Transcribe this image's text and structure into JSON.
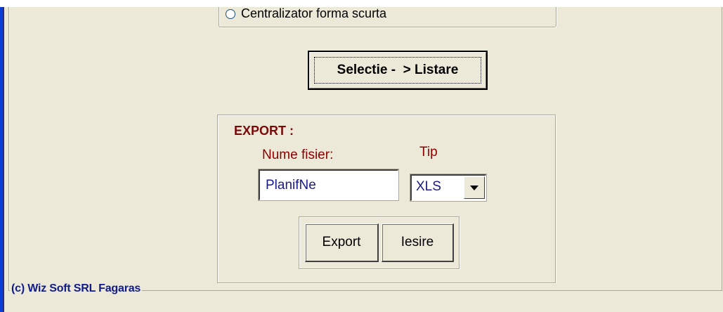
{
  "options": {
    "radio_label": "Centralizator forma scurta"
  },
  "actions": {
    "select_button_label": "Selectie -  > Listare"
  },
  "export": {
    "title": "EXPORT :",
    "filename_label": "Nume fisier:",
    "filename_value": "PlanifNe",
    "type_label": "Tip",
    "type_value": "XLS",
    "export_button_label": "Export",
    "exit_button_label": "Iesire"
  },
  "footer": {
    "copyright": "(c) Wiz Soft SRL Fagaras"
  },
  "colors": {
    "background": "#ECE9D8",
    "label_red": "#8b0000",
    "value_blue": "#1a1a8c",
    "footer_blue": "#101c8c",
    "window_edge_blue": "#0A3DD6"
  }
}
